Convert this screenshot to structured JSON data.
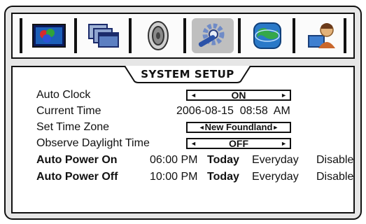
{
  "menu": {
    "tabs": [
      {
        "icon": "display-icon"
      },
      {
        "icon": "windows-icon"
      },
      {
        "icon": "speaker-icon"
      },
      {
        "icon": "settings-tool-icon"
      },
      {
        "icon": "globe-icon"
      },
      {
        "icon": "user-icon"
      }
    ],
    "active_tab": 3
  },
  "panel": {
    "title": "SYSTEM SETUP",
    "auto_clock": {
      "label": "Auto Clock",
      "value": "ON"
    },
    "current_time": {
      "label": "Current Time",
      "value": "2006-08-15  08:58  AM"
    },
    "time_zone": {
      "label": "Set Time Zone",
      "value": "New Foundland"
    },
    "daylight": {
      "label": "Observe Daylight Time",
      "value": "OFF"
    },
    "power_on": {
      "label": "Auto Power On",
      "time": "06:00 PM",
      "day": "Today",
      "repeat": "Everyday",
      "state": "Disable"
    },
    "power_off": {
      "label": "Auto Power Off",
      "time": "10:00 PM",
      "day": "Today",
      "repeat": "Everyday",
      "state": "Disable"
    }
  },
  "colors": {
    "frame": "#e6e6e6",
    "active_tab": "#bfbfbf",
    "border": "#111111"
  }
}
